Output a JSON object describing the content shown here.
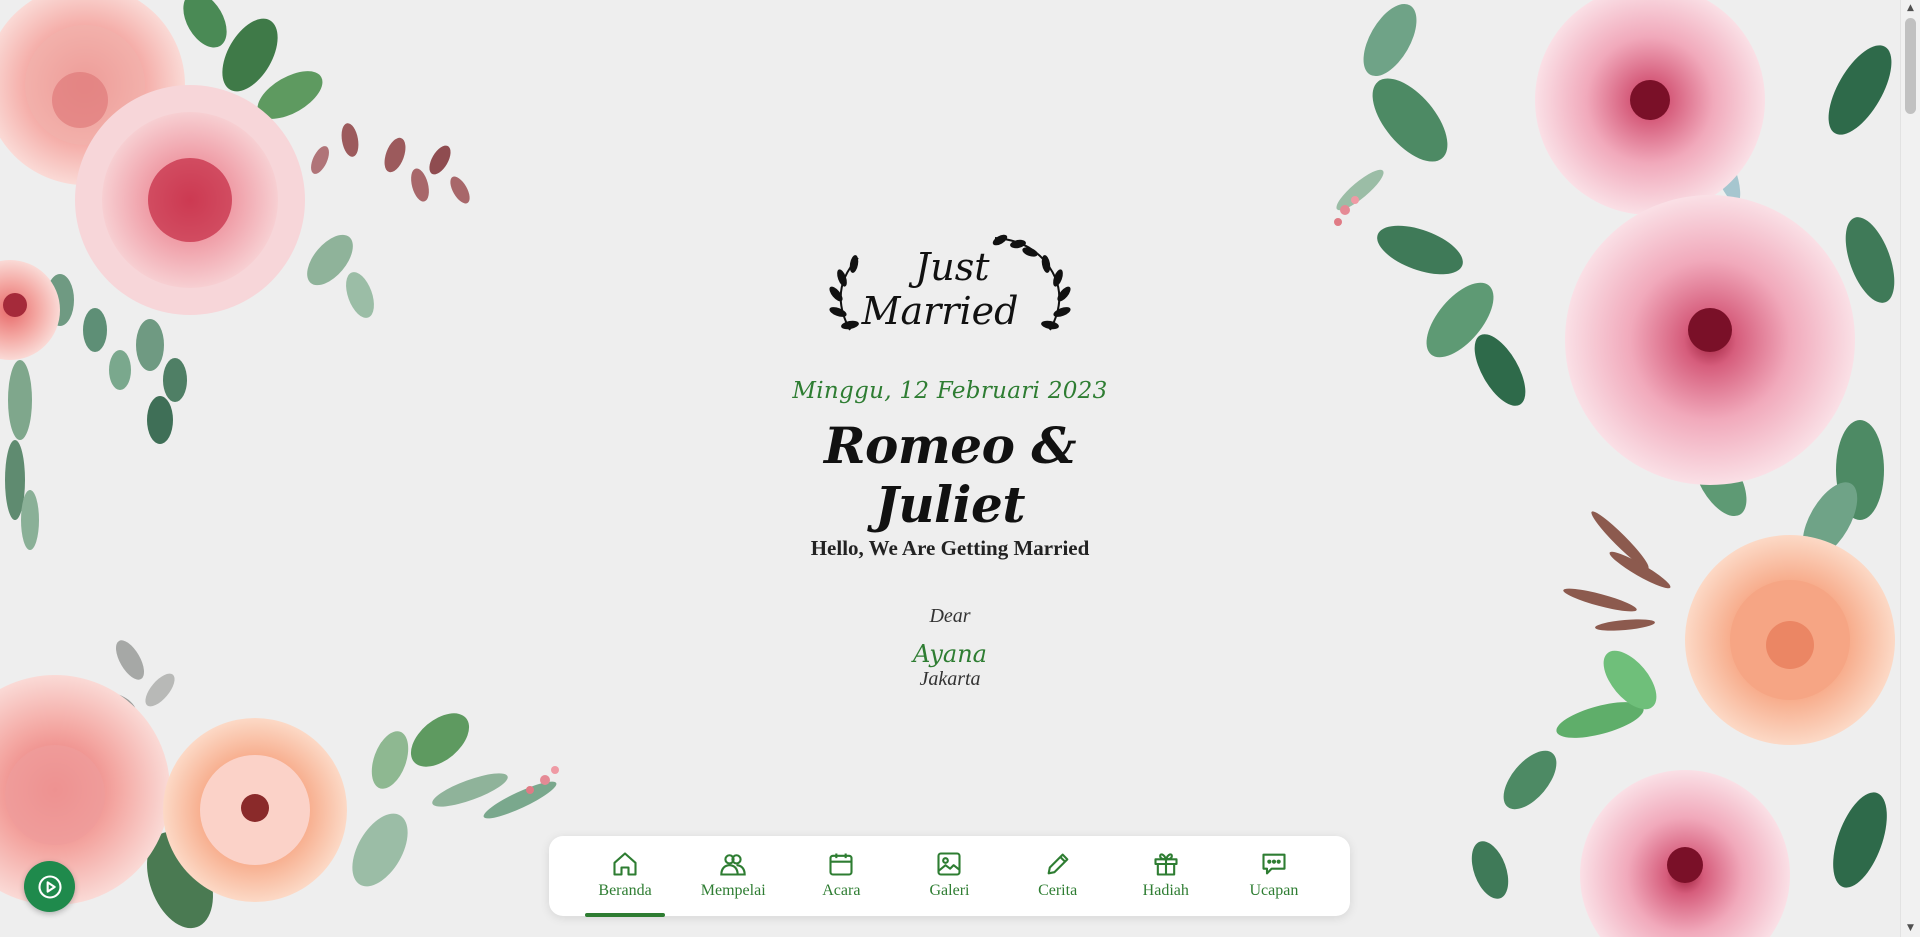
{
  "logo": {
    "line1": "Just",
    "line2": "Married"
  },
  "hero": {
    "date": "Minggu, 12 Februari 2023",
    "couple": "Romeo & Juliet",
    "tagline": "Hello, We Are Getting Married"
  },
  "guest": {
    "greeting": "Dear",
    "name": "Ayana",
    "city": "Jakarta"
  },
  "nav": {
    "items": [
      {
        "label": "Beranda",
        "icon": "home-icon",
        "active": true
      },
      {
        "label": "Mempelai",
        "icon": "couple-icon",
        "active": false
      },
      {
        "label": "Acara",
        "icon": "calendar-icon",
        "active": false
      },
      {
        "label": "Galeri",
        "icon": "image-icon",
        "active": false
      },
      {
        "label": "Cerita",
        "icon": "pencil-icon",
        "active": false
      },
      {
        "label": "Hadiah",
        "icon": "gift-icon",
        "active": false
      },
      {
        "label": "Ucapan",
        "icon": "chat-icon",
        "active": false
      }
    ]
  },
  "music": {
    "icon": "play-circle-icon"
  },
  "colors": {
    "accent": "#2e7d32",
    "background": "#eeeeee",
    "music_button": "#1f8a4c"
  }
}
